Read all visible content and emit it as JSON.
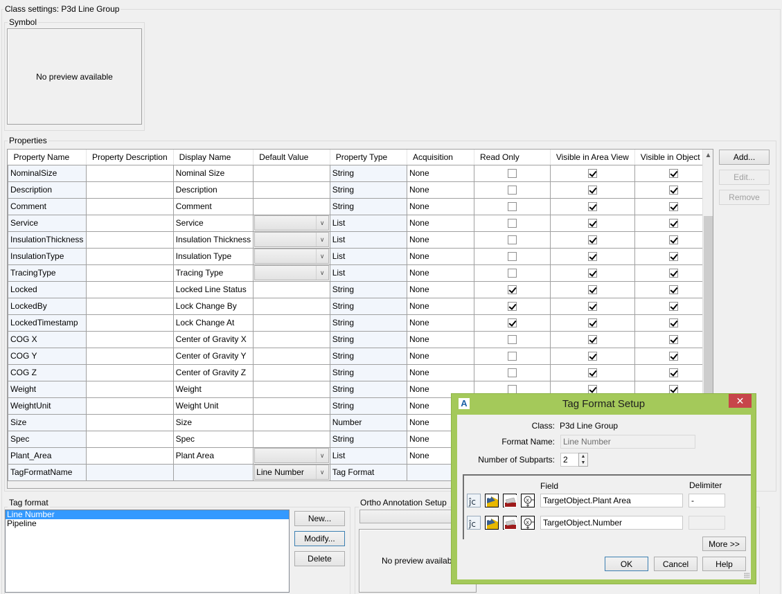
{
  "class_settings": {
    "title": "Class settings: P3d Line Group"
  },
  "symbol": {
    "title": "Symbol",
    "preview_text": "No preview available"
  },
  "properties": {
    "title": "Properties",
    "columns": [
      "Property Name",
      "Property Description",
      "Display Name",
      "Default Value",
      "Property Type",
      "Acquisition",
      "Read Only",
      "Visible in Area View",
      "Visible in Object"
    ],
    "rows": [
      {
        "name": "NominalSize",
        "description": "",
        "display": "Nominal Size",
        "default": "",
        "default_combo": false,
        "type": "String",
        "acquisition": "None",
        "read_only": false,
        "vis_area": true,
        "vis_object": true
      },
      {
        "name": "Description",
        "description": "",
        "display": "Description",
        "default": "",
        "default_combo": false,
        "type": "String",
        "acquisition": "None",
        "read_only": false,
        "vis_area": true,
        "vis_object": true
      },
      {
        "name": "Comment",
        "description": "",
        "display": "Comment",
        "default": "",
        "default_combo": false,
        "type": "String",
        "acquisition": "None",
        "read_only": false,
        "vis_area": true,
        "vis_object": true
      },
      {
        "name": "Service",
        "description": "",
        "display": "Service",
        "default": "",
        "default_combo": true,
        "type": "List",
        "acquisition": "None",
        "read_only": false,
        "vis_area": true,
        "vis_object": true
      },
      {
        "name": "InsulationThickness",
        "description": "",
        "display": "Insulation Thickness",
        "default": "",
        "default_combo": true,
        "type": "List",
        "acquisition": "None",
        "read_only": false,
        "vis_area": true,
        "vis_object": true
      },
      {
        "name": "InsulationType",
        "description": "",
        "display": "Insulation Type",
        "default": "",
        "default_combo": true,
        "type": "List",
        "acquisition": "None",
        "read_only": false,
        "vis_area": true,
        "vis_object": true
      },
      {
        "name": "TracingType",
        "description": "",
        "display": "Tracing Type",
        "default": "",
        "default_combo": true,
        "type": "List",
        "acquisition": "None",
        "read_only": false,
        "vis_area": true,
        "vis_object": true
      },
      {
        "name": "Locked",
        "description": "",
        "display": "Locked Line Status",
        "default": "",
        "default_combo": false,
        "type": "String",
        "acquisition": "None",
        "read_only": true,
        "vis_area": true,
        "vis_object": true
      },
      {
        "name": "LockedBy",
        "description": "",
        "display": "Lock Change By",
        "default": "",
        "default_combo": false,
        "type": "String",
        "acquisition": "None",
        "read_only": true,
        "vis_area": true,
        "vis_object": true
      },
      {
        "name": "LockedTimestamp",
        "description": "",
        "display": "Lock Change At",
        "default": "",
        "default_combo": false,
        "type": "String",
        "acquisition": "None",
        "read_only": true,
        "vis_area": true,
        "vis_object": true
      },
      {
        "name": "COG X",
        "description": "",
        "display": "Center of Gravity X",
        "default": "",
        "default_combo": false,
        "type": "String",
        "acquisition": "None",
        "read_only": false,
        "vis_area": true,
        "vis_object": true
      },
      {
        "name": "COG Y",
        "description": "",
        "display": "Center of Gravity Y",
        "default": "",
        "default_combo": false,
        "type": "String",
        "acquisition": "None",
        "read_only": false,
        "vis_area": true,
        "vis_object": true
      },
      {
        "name": "COG Z",
        "description": "",
        "display": "Center of Gravity Z",
        "default": "",
        "default_combo": false,
        "type": "String",
        "acquisition": "None",
        "read_only": false,
        "vis_area": true,
        "vis_object": true
      },
      {
        "name": "Weight",
        "description": "",
        "display": "Weight",
        "default": "",
        "default_combo": false,
        "type": "String",
        "acquisition": "None",
        "read_only": false,
        "vis_area": true,
        "vis_object": true
      },
      {
        "name": "WeightUnit",
        "description": "",
        "display": "Weight Unit",
        "default": "",
        "default_combo": false,
        "type": "String",
        "acquisition": "None",
        "read_only": null,
        "vis_area": null,
        "vis_object": null
      },
      {
        "name": "Size",
        "description": "",
        "display": "Size",
        "default": "",
        "default_combo": false,
        "type": "Number",
        "acquisition": "None",
        "read_only": null,
        "vis_area": null,
        "vis_object": null
      },
      {
        "name": "Spec",
        "description": "",
        "display": "Spec",
        "default": "",
        "default_combo": false,
        "type": "String",
        "acquisition": "None",
        "read_only": null,
        "vis_area": null,
        "vis_object": null
      },
      {
        "name": "Plant_Area",
        "description": "",
        "display": "Plant Area",
        "default": "",
        "default_combo": true,
        "type": "List",
        "acquisition": "None",
        "read_only": null,
        "vis_area": null,
        "vis_object": null
      },
      {
        "name": "TagFormatName",
        "description": "",
        "display": "",
        "default": "Line Number",
        "default_combo": true,
        "type": "Tag Format",
        "acquisition": "",
        "read_only": null,
        "vis_area": null,
        "vis_object": null,
        "readonly_row": true
      }
    ],
    "buttons": {
      "add": "Add...",
      "edit": "Edit...",
      "remove": "Remove"
    }
  },
  "tag_format": {
    "title": "Tag format",
    "items": [
      {
        "label": "Line Number",
        "selected": true
      },
      {
        "label": "Pipeline",
        "selected": false
      }
    ],
    "buttons": {
      "new": "New...",
      "modify": "Modify...",
      "delete": "Delete"
    }
  },
  "ortho": {
    "title": "Ortho Annotation Setup",
    "dropdown_value": "",
    "preview_text": "No preview available"
  },
  "dialog": {
    "title": "Tag Format Setup",
    "app_icon": "A",
    "close_glyph": "✕",
    "class_label": "Class:",
    "class_value": "P3d Line Group",
    "format_name_label": "Format Name:",
    "format_name_value": "Line Number",
    "subparts_label": "Number of Subparts:",
    "subparts_value": "2",
    "field_header": "Field",
    "delimiter_header": "Delimiter",
    "subparts": [
      {
        "field": "TargetObject.Plant Area",
        "delimiter": "-"
      },
      {
        "field": "TargetObject.Number",
        "delimiter": ""
      }
    ],
    "buttons": {
      "more": "More >>",
      "ok": "OK",
      "cancel": "Cancel",
      "help": "Help"
    }
  }
}
